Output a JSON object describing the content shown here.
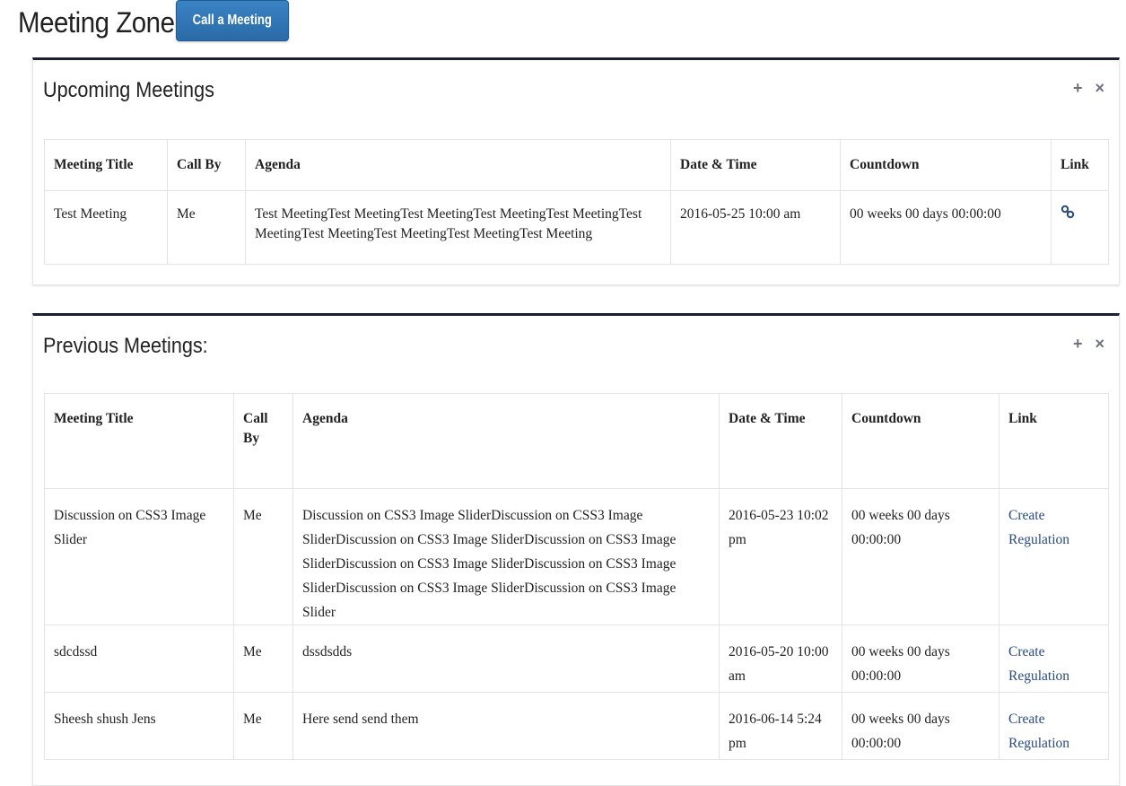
{
  "header": {
    "title": "Meeting Zone:",
    "call_button": "Call a Meeting"
  },
  "upcoming": {
    "title": "Upcoming Meetings",
    "tools": {
      "expand": "+",
      "close": "×"
    },
    "columns": [
      "Meeting Title",
      "Call By",
      "Agenda",
      "Date & Time",
      "Countdown",
      "Link"
    ],
    "rows": [
      {
        "title": "Test Meeting",
        "call_by": "Me",
        "agenda": "Test MeetingTest MeetingTest MeetingTest MeetingTest MeetingTest MeetingTest MeetingTest MeetingTest MeetingTest Meeting",
        "datetime": "2016-05-25 10:00 am",
        "countdown": "00 weeks 00 days 00:00:00",
        "link_icon": "link-icon"
      }
    ]
  },
  "previous": {
    "title": "Previous Meetings:",
    "tools": {
      "expand": "+",
      "close": "×"
    },
    "columns": [
      "Meeting Title",
      "Call By",
      "Agenda",
      "Date & Time",
      "Countdown",
      "Link"
    ],
    "rows": [
      {
        "title": "Discussion on CSS3 Image Slider",
        "call_by": "Me",
        "agenda": "Discussion on CSS3 Image SliderDiscussion on CSS3 Image SliderDiscussion on CSS3 Image SliderDiscussion on CSS3 Image SliderDiscussion on CSS3 Image SliderDiscussion on CSS3 Image SliderDiscussion on CSS3 Image SliderDiscussion on CSS3 Image Slider",
        "datetime": "2016-05-23 10:02 pm",
        "countdown": "00 weeks 00 days 00:00:00",
        "link": "Create Regulation"
      },
      {
        "title": "sdcdssd",
        "call_by": "Me",
        "agenda": "dssdsdds",
        "datetime": "2016-05-20 10:00 am",
        "countdown": "00 weeks 00 days 00:00:00",
        "link": "Create Regulation"
      },
      {
        "title": "Sheesh shush Jens",
        "call_by": "Me",
        "agenda": "Here send send them",
        "datetime": "2016-06-14 5:24 pm",
        "countdown": "00 weeks 00 days 00:00:00",
        "link": "Create Regulation"
      }
    ]
  },
  "colors": {
    "button": "#2f75b5",
    "panel_border": "#1c1f2e",
    "link": "#2a4a80"
  }
}
